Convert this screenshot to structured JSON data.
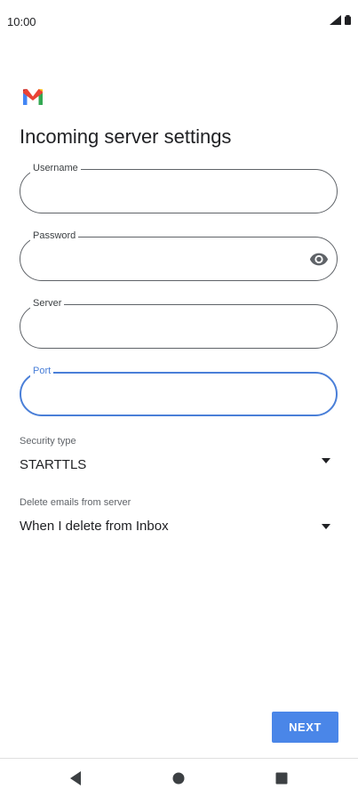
{
  "status_bar": {
    "time": "10:00",
    "icons": [
      "signal-icon",
      "battery-icon"
    ]
  },
  "app": {
    "logo": "gmail-logo"
  },
  "page_title": "Incoming server settings",
  "fields": {
    "username": {
      "label": "Username",
      "value": ""
    },
    "password": {
      "label": "Password",
      "value": ""
    },
    "server": {
      "label": "Server",
      "value": ""
    },
    "port": {
      "label": "Port",
      "value": ""
    }
  },
  "security_type": {
    "label": "Security type",
    "value": "STARTTLS"
  },
  "delete_emails": {
    "label": "Delete emails from server",
    "value": "When I delete from Inbox"
  },
  "next_label": "NEXT",
  "colors": {
    "accent": "#4a86e8",
    "focus": "#4a7fd8",
    "outline": "#5f6368"
  },
  "navigation": {
    "icons": [
      "back-icon",
      "home-icon",
      "recents-icon"
    ]
  }
}
